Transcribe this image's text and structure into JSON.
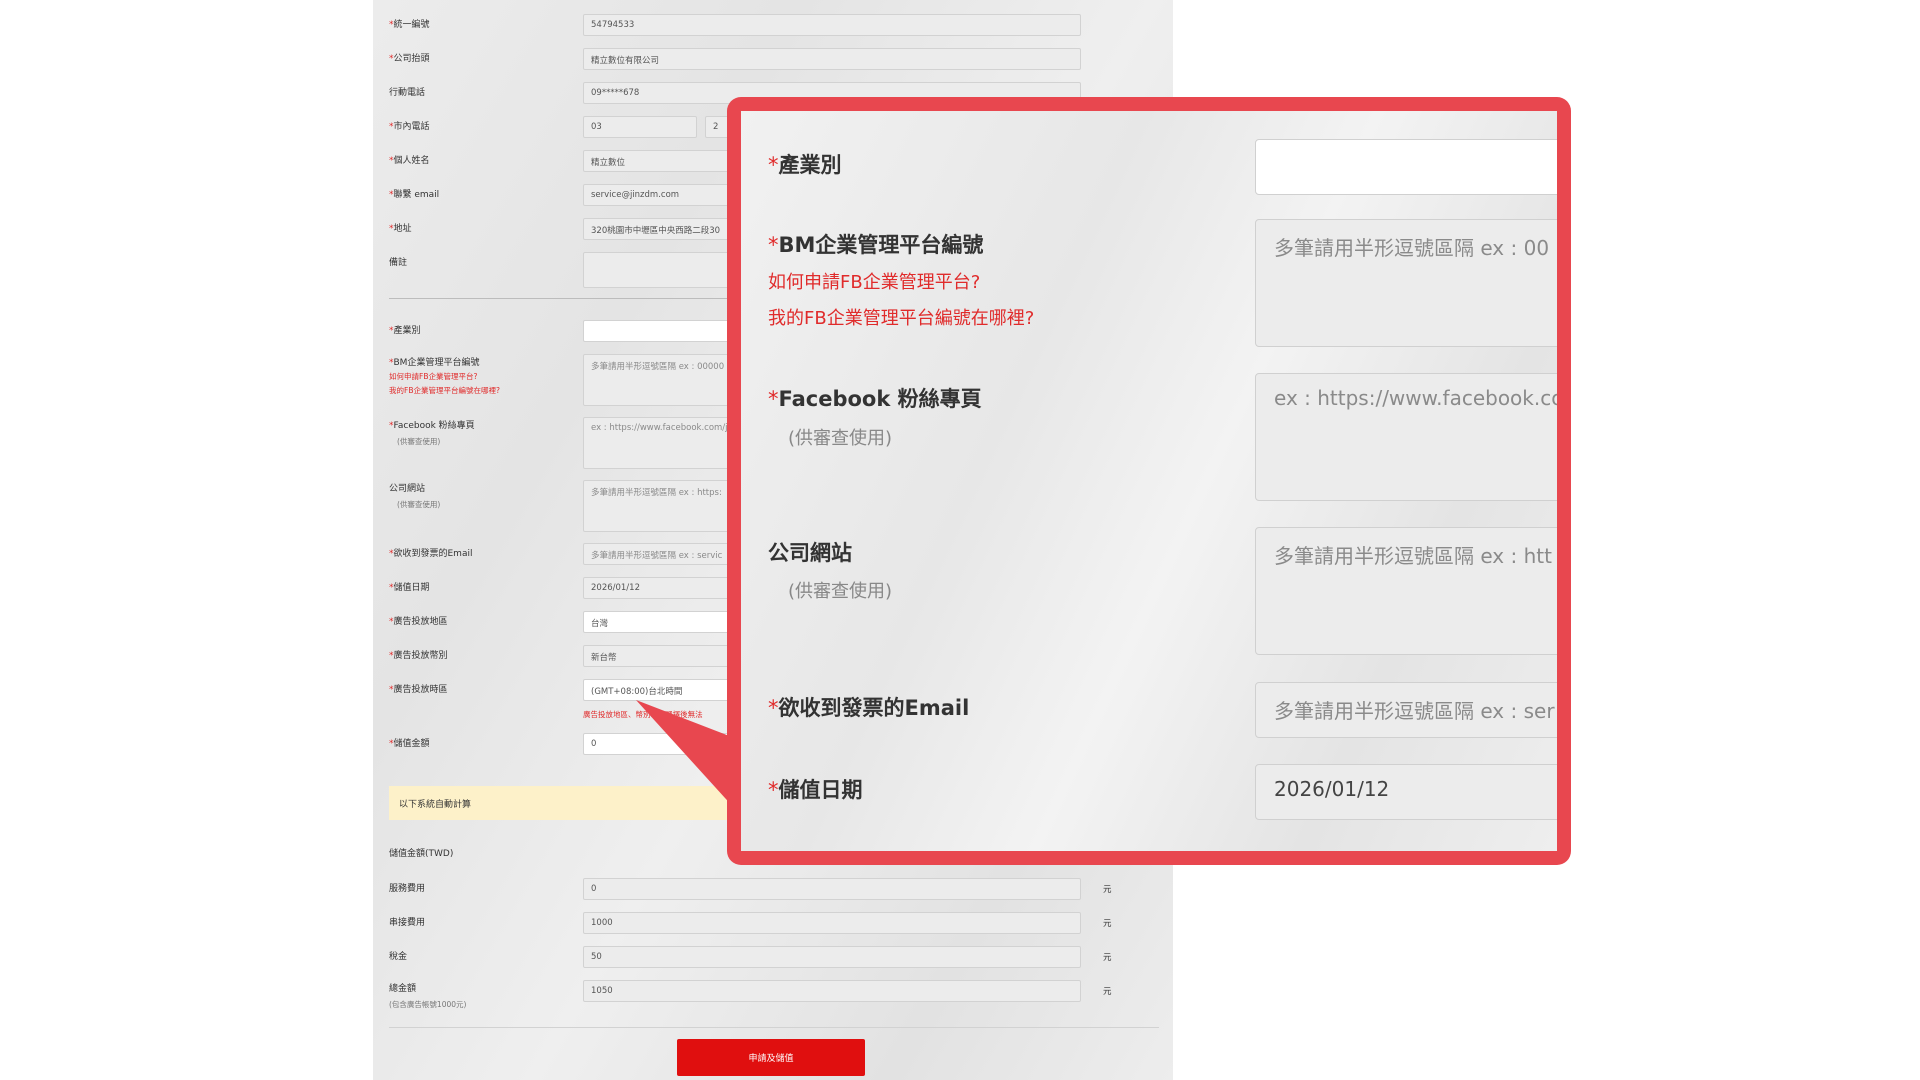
{
  "form": {
    "tax_id_label": "統一編號",
    "tax_id_value": "54794533",
    "company_name_label": "公司抬頭",
    "company_name_value": "精立數位有限公司",
    "mobile_label": "行動電話",
    "mobile_value": "09*****678",
    "phone_label": "市內電話",
    "phone_area_value": "03",
    "phone_number_value": "2",
    "personal_name_label": "個人姓名",
    "personal_name_value": "精立數位",
    "email_label": "聯繫 email",
    "email_value": "service@jinzdm.com",
    "address_label": "地址",
    "address_value": "320桃園市中壢區中央西路二段30",
    "note_label": "備註",
    "industry_label": "產業別",
    "bm_label": "BM企業管理平台編號",
    "bm_link1": "如何申請FB企業管理平台?",
    "bm_link2": "我的FB企業管理平台編號在哪裡?",
    "bm_placeholder": "多筆請用半形逗號區隔 ex : 00000",
    "fb_label": "Facebook 粉絲專頁",
    "fb_sub": "(供審查使用)",
    "fb_placeholder": "ex : https://www.facebook.com/jin",
    "website_label": "公司網站",
    "website_sub": "(供審查使用)",
    "website_placeholder": "多筆請用半形逗號區隔 ex : https:",
    "invoice_email_label": "欲收到發票的Email",
    "invoice_email_placeholder": "多筆請用半形逗號區隔 ex : servic",
    "date_label": "儲值日期",
    "date_value": "2026/01/12",
    "region_label": "廣告投放地區",
    "region_value": "台灣",
    "currency_label": "廣告投放幣別",
    "currency_value": "新台幣",
    "timezone_label": "廣告投放時區",
    "timezone_value": "(GMT+08:00)台北時間",
    "timezone_hint": "廣告投放地區、幣別...若選擇後無法",
    "amount_label": "儲值金額",
    "amount_value": "0",
    "auto_calc_notice": "以下系統自動計算",
    "twd_label": "儲值金額(TWD)",
    "service_fee_label": "服務費用",
    "service_fee_value": "0",
    "connect_fee_label": "串接費用",
    "connect_fee_value": "1000",
    "tax_label": "稅金",
    "tax_value": "50",
    "total_label": "總金額",
    "total_sub": "(包含廣告帳號1000元)",
    "total_value": "1050",
    "unit": "元",
    "submit_label": "申請及儲值"
  },
  "zoom": {
    "industry_label": "產業別",
    "bm_label": "BM企業管理平台編號",
    "bm_link1": "如何申請FB企業管理平台?",
    "bm_link2": "我的FB企業管理平台編號在哪裡?",
    "bm_placeholder": "多筆請用半形逗號區隔 ex : 00",
    "fb_label": "Facebook 粉絲專頁",
    "fb_sub": "(供審查使用)",
    "fb_placeholder": "ex : https://www.facebook.com",
    "website_label": "公司網站",
    "website_sub": "(供審查使用)",
    "website_placeholder": "多筆請用半形逗號區隔 ex : htt",
    "invoice_email_label": "欲收到發票的Email",
    "invoice_email_placeholder": "多筆請用半形逗號區隔 ex : ser",
    "date_label": "儲值日期",
    "date_value": "2026/01/12"
  },
  "required_mark": "*",
  "colors": {
    "callout_border": "#e8474f",
    "required": "#e02b2b",
    "submit": "#e00f0f",
    "notice_bg": "#fdf1c9"
  }
}
